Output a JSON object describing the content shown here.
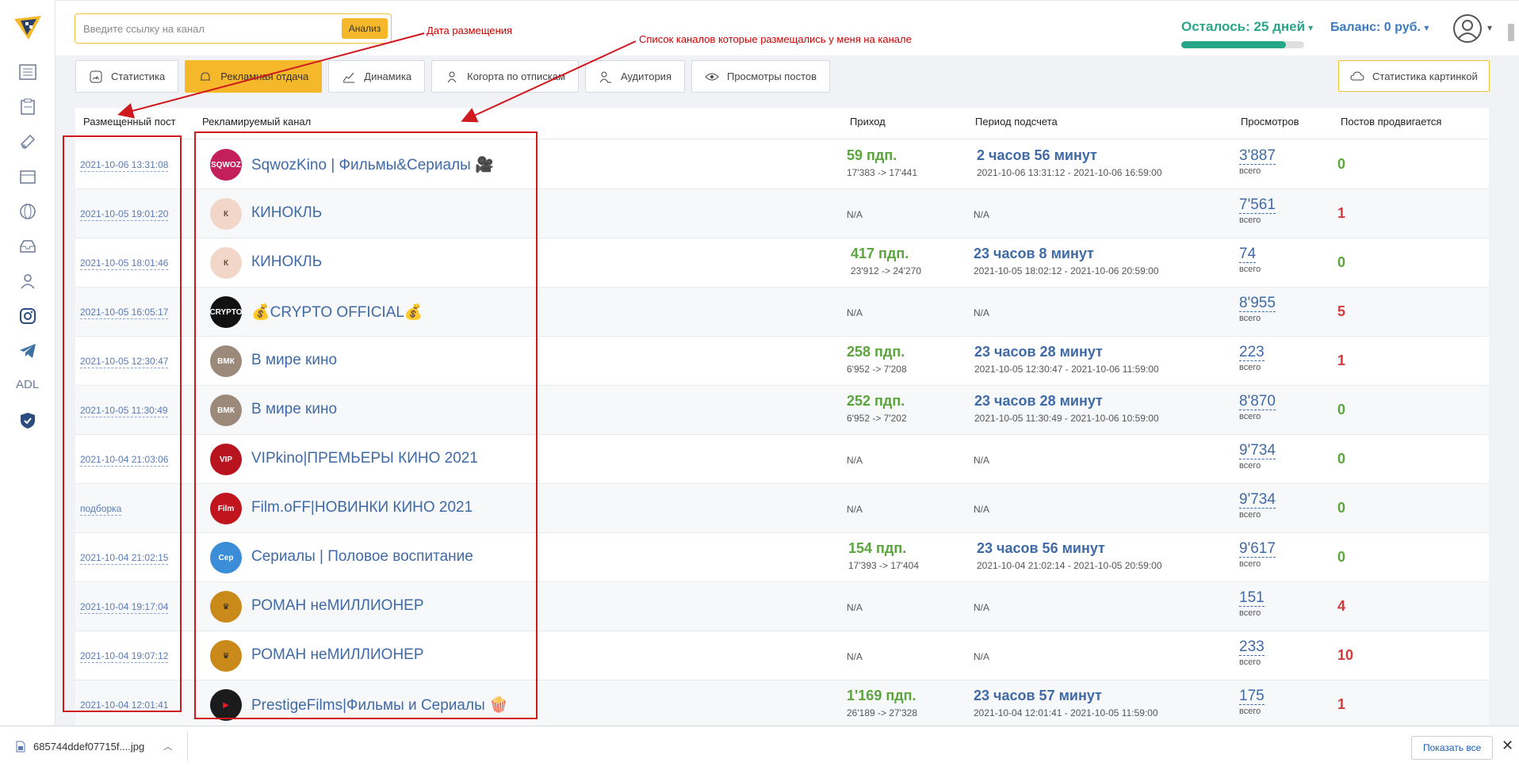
{
  "search": {
    "placeholder": "Введите ссылку на канал",
    "button": "Анализ"
  },
  "status": {
    "days_left": "Осталось: 25 дней",
    "days_progress": 0.85,
    "balance": "Баланс: 0 руб."
  },
  "tabs": [
    {
      "label": "Статистика",
      "icon": "speedometer-icon",
      "active": false
    },
    {
      "label": "Рекламная отдача",
      "icon": "bell-icon",
      "active": true
    },
    {
      "label": "Динамика",
      "icon": "chart-icon",
      "active": false
    },
    {
      "label": "Когорта по отпискам",
      "icon": "person-icon",
      "active": false
    },
    {
      "label": "Аудитория",
      "icon": "users-icon",
      "active": false
    },
    {
      "label": "Просмотры постов",
      "icon": "eye-icon",
      "active": false
    }
  ],
  "pic_stats": "Статистика картинкой",
  "sidebar": {
    "adl": "ADL"
  },
  "table": {
    "headers": {
      "post": "Размещенный пост",
      "channel": "Рекламируемый канал",
      "income": "Приход",
      "period": "Период подсчета",
      "views": "Просмотров",
      "promoted": "Постов продвигается"
    },
    "rows": [
      {
        "date": "2021-10-06 13:31:08",
        "channel": "SqwozKino | Фильмы&Сериалы 🎥",
        "income": "59 пдп.",
        "income_range": "17'383 -> 17'441",
        "period": "2 часов 56 минут",
        "period_range": "2021-10-06 13:31:12 - 2021-10-06 16:59:00",
        "views": "3'887",
        "views_sub": "всего",
        "promoted": "0"
      },
      {
        "date": "2021-10-05 19:01:20",
        "channel": "КИНОКЛЬ",
        "income": "N/A",
        "income_range": "",
        "period": "N/A",
        "period_range": "",
        "views": "7'561",
        "views_sub": "всего",
        "promoted": "1"
      },
      {
        "date": "2021-10-05 18:01:46",
        "channel": "КИНОКЛЬ",
        "income": "417 пдп.",
        "income_range": "23'912 -> 24'270",
        "period": "23 часов 8 минут",
        "period_range": "2021-10-05 18:02:12 - 2021-10-06 20:59:00",
        "views": "74",
        "views_sub": "всего",
        "promoted": "0"
      },
      {
        "date": "2021-10-05 16:05:17",
        "channel": "💰CRYPTO OFFICIAL💰",
        "income": "N/A",
        "income_range": "",
        "period": "N/A",
        "period_range": "",
        "views": "8'955",
        "views_sub": "всего",
        "promoted": "5"
      },
      {
        "date": "2021-10-05 12:30:47",
        "channel": "В мире кино",
        "income": "258 пдп.",
        "income_range": "6'952 -> 7'208",
        "period": "23 часов 28 минут",
        "period_range": "2021-10-05 12:30:47 - 2021-10-06 11:59:00",
        "views": "223",
        "views_sub": "всего",
        "promoted": "1"
      },
      {
        "date": "2021-10-05 11:30:49",
        "channel": "В мире кино",
        "income": "252 пдп.",
        "income_range": "6'952 -> 7'202",
        "period": "23 часов 28 минут",
        "period_range": "2021-10-05 11:30:49 - 2021-10-06 10:59:00",
        "views": "8'870",
        "views_sub": "всего",
        "promoted": "0"
      },
      {
        "date": "2021-10-04 21:03:06",
        "channel": "VIPkino|ПРЕМЬЕРЫ КИНО 2021",
        "income": "N/A",
        "income_range": "",
        "period": "N/A",
        "period_range": "",
        "views": "9'734",
        "views_sub": "всего",
        "promoted": "0"
      },
      {
        "date": "подборка",
        "channel": "Film.oFF|НОВИНКИ КИНО 2021",
        "income": "N/A",
        "income_range": "",
        "period": "N/A",
        "period_range": "",
        "views": "9'734",
        "views_sub": "всего",
        "promoted": "0"
      },
      {
        "date": "2021-10-04 21:02:15",
        "channel": "Сериалы | Половое воспитание",
        "income": "154 пдп.",
        "income_range": "17'393 -> 17'404",
        "period": "23 часов 56 минут",
        "period_range": "2021-10-04 21:02:14 - 2021-10-05 20:59:00",
        "views": "9'617",
        "views_sub": "всего",
        "promoted": "0"
      },
      {
        "date": "2021-10-04 19:17:04",
        "channel": "РОМАН неМИЛЛИОНЕР",
        "income": "N/A",
        "income_range": "",
        "period": "N/A",
        "period_range": "",
        "views": "151",
        "views_sub": "всего",
        "promoted": "4"
      },
      {
        "date": "2021-10-04 19:07:12",
        "channel": "РОМАН неМИЛЛИОНЕР",
        "income": "N/A",
        "income_range": "",
        "period": "N/A",
        "period_range": "",
        "views": "233",
        "views_sub": "всего",
        "promoted": "10"
      },
      {
        "date": "2021-10-04 12:01:41",
        "channel": "PrestigeFilms|Фильмы и Сериалы 🍿",
        "income": "1'169 пдп.",
        "income_range": "26'189 -> 27'328",
        "period": "23 часов 57 минут",
        "period_range": "2021-10-04 12:01:41 - 2021-10-05 11:59:00",
        "views": "175",
        "views_sub": "всего",
        "promoted": "1"
      }
    ]
  },
  "annotations": {
    "date_note": "Дата размещения",
    "channels_note": "Список каналов которые размещались у меня на канале"
  },
  "download": {
    "filename": "685744ddef07715f....jpg",
    "show_all": "Показать все"
  },
  "colors": {
    "accent": "#f6b82b",
    "green": "#5aa53c",
    "link": "#3f6aa6",
    "red": "#d23a3a",
    "annotation": "#d0181f"
  }
}
